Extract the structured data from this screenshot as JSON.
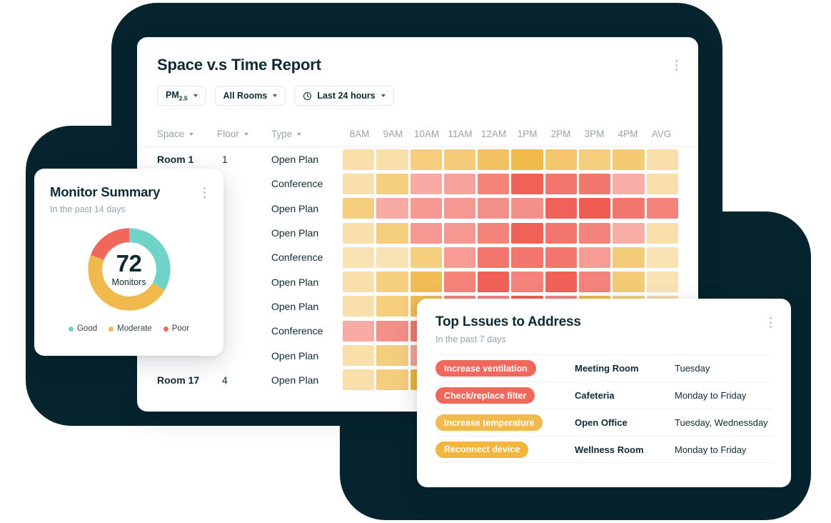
{
  "theme": {
    "dark_bg": "#06242E",
    "text_dark": "#102A33",
    "text_muted": "#98A4AA",
    "good": "#6FD3C7",
    "moderate": "#F0B94C",
    "poor": "#F0675B"
  },
  "report": {
    "title": "Space v.s Time Report",
    "kebab_icon": "more-vertical-icon",
    "filters": [
      {
        "label": "PM",
        "sub": "2.5",
        "icon": null,
        "caret": true
      },
      {
        "label": "All Rooms",
        "sub": null,
        "icon": null,
        "caret": true
      },
      {
        "label": "Last 24 hours",
        "sub": null,
        "icon": "clock-icon",
        "caret": true
      }
    ],
    "sort_columns": [
      {
        "label": "Space"
      },
      {
        "label": "Floor"
      },
      {
        "label": "Type"
      }
    ],
    "time_columns": [
      "8AM",
      "9AM",
      "10AM",
      "11AM",
      "12AM",
      "1PM",
      "2PM",
      "3PM",
      "4PM",
      "AVG"
    ],
    "rows": [
      {
        "space": "Room 1",
        "floor": "1",
        "type": "Open Plan",
        "values": [
          "#F9DFA9",
          "#F9DFA9",
          "#F4CE7D",
          "#F4CC77",
          "#F2C162",
          "#F0B94C",
          "#F4C76C",
          "#F5CE7E",
          "#F4CA73",
          "#F9DFA9"
        ]
      },
      {
        "space": "",
        "floor": "",
        "type": "Conference",
        "values": [
          "#F9DFA9",
          "#F5CE7E",
          "#F7ABA4",
          "#F6A39B",
          "#F4837A",
          "#F06257",
          "#F2766E",
          "#F2776F",
          "#F8AEA7",
          "#F9DFA9"
        ]
      },
      {
        "space": "",
        "floor": "",
        "type": "Open Plan",
        "values": [
          "#F4CE7D",
          "#F7ABA4",
          "#F59891",
          "#F59891",
          "#F4908A",
          "#F4908A",
          "#F06257",
          "#F05B50",
          "#F2776F",
          "#F3837B"
        ]
      },
      {
        "space": "",
        "floor": "",
        "type": "Open Plan",
        "values": [
          "#F9DFA9",
          "#F4CE7D",
          "#F59891",
          "#F59891",
          "#F4837A",
          "#F06257",
          "#F2766E",
          "#F3837B",
          "#F8AEA7",
          "#F9DFA9"
        ]
      },
      {
        "space": "",
        "floor": "",
        "type": "Conference",
        "values": [
          "#FAE3B3",
          "#FAE3B3",
          "#F5CE7E",
          "#F79B94",
          "#F2766E",
          "#F2766E",
          "#F2766E",
          "#F79B94",
          "#F4CC77",
          "#FAE3B3"
        ]
      },
      {
        "space": "",
        "floor": "",
        "type": "Open Plan",
        "values": [
          "#F9DFA9",
          "#F5CE7E",
          "#F1BC55",
          "#F4837A",
          "#F06257",
          "#F3837B",
          "#F06257",
          "#F3837B",
          "#F4CC77",
          "#FAE3B3"
        ]
      },
      {
        "space": "",
        "floor": "",
        "type": "Open Plan",
        "values": [
          "#F9DFA9",
          "#F5CE7E",
          "#F1BC55",
          "#F4837A",
          "#F4837A",
          "#F06257",
          "#F3837B",
          "#F2B948",
          "#F2CB84",
          "#F6DCAE"
        ]
      },
      {
        "space": "",
        "floor": "",
        "type": "Conference",
        "values": [
          "#F7ABA4",
          "#F4908A",
          "#EF7B72",
          "#F4908A",
          "#F4908A",
          "#F4837A",
          "#F3837B",
          "#F4CC77",
          "#F5CE7E",
          "#F9DFA9"
        ]
      },
      {
        "space": "",
        "floor": "",
        "type": "Open Plan",
        "values": [
          "#F9DFA9",
          "#F4CE7D",
          "#F3A39C",
          "#F79B94",
          "#F4908A",
          "#F5CE7E",
          "#F5CE7E",
          "#F9DFA9",
          "#F9DFA9",
          "#FAE3B3"
        ]
      },
      {
        "space": "Room 17",
        "floor": "4",
        "type": "Open Plan",
        "values": [
          "#F9DFA9",
          "#F4CE7D",
          "#EDB63F",
          "#F4CC77",
          "#F5CE7E",
          "#F4CE7D",
          "#F9DFA9",
          "#FAE3B3",
          "#FAE3B3",
          "#FAE3B3"
        ]
      }
    ]
  },
  "monitor": {
    "title": "Monitor Summary",
    "subtitle": "In the past 14 days",
    "kebab_icon": "more-vertical-icon",
    "count": "72",
    "count_label": "Monitors",
    "legend": [
      {
        "label": "Good",
        "color": "#6FD3C7"
      },
      {
        "label": "Moderate",
        "color": "#F0B94C"
      },
      {
        "label": "Poor",
        "color": "#F0675B"
      }
    ]
  },
  "issues": {
    "title": "Top Lssues to Address",
    "subtitle": "In the past 7 days",
    "kebab_icon": "more-vertical-icon",
    "rows": [
      {
        "tag": "Increase ventilation",
        "tag_color": "#F0675B",
        "location": "Meeting Room",
        "when": "Tuesday"
      },
      {
        "tag": "Check/replace filter",
        "tag_color": "#F0675B",
        "location": "Cafeteria",
        "when": "Monday to Friday"
      },
      {
        "tag": "Increase temperature",
        "tag_color": "#F2B94E",
        "location": "Open Office",
        "when": "Tuesday, Wednessday"
      },
      {
        "tag": "Reconnect device",
        "tag_color": "#F0B63F",
        "location": "Wellness Room",
        "when": "Monday to Friday"
      }
    ]
  },
  "chart_data": {
    "type": "pie",
    "title": "Monitor Summary",
    "subtitle": "In the past 14 days",
    "center_value": 72,
    "center_label": "Monitors",
    "labels": [
      "Good",
      "Moderate",
      "Poor"
    ],
    "values": [
      24,
      34,
      14
    ],
    "percentages": [
      33.3,
      47.2,
      19.5
    ],
    "colors": [
      "#6FD3C7",
      "#F0B94C",
      "#F0675B"
    ],
    "legend_position": "bottom",
    "donut_hole_ratio": 0.62
  },
  "heatmap_data": {
    "type": "heatmap",
    "title": "Space v.s Time Report",
    "xlabel": "",
    "ylabel": "",
    "x": [
      "8AM",
      "9AM",
      "10AM",
      "11AM",
      "12AM",
      "1PM",
      "2PM",
      "3PM",
      "4PM",
      "AVG"
    ],
    "y": [
      "Open Plan",
      "Conference",
      "Open Plan",
      "Open Plan",
      "Conference",
      "Open Plan",
      "Open Plan",
      "Conference",
      "Open Plan",
      "Open Plan"
    ],
    "metric": "PM2.5",
    "scale_low_color": "#FAE3B3",
    "scale_high_color": "#F05B50",
    "grid": false,
    "legend_position": "none"
  }
}
